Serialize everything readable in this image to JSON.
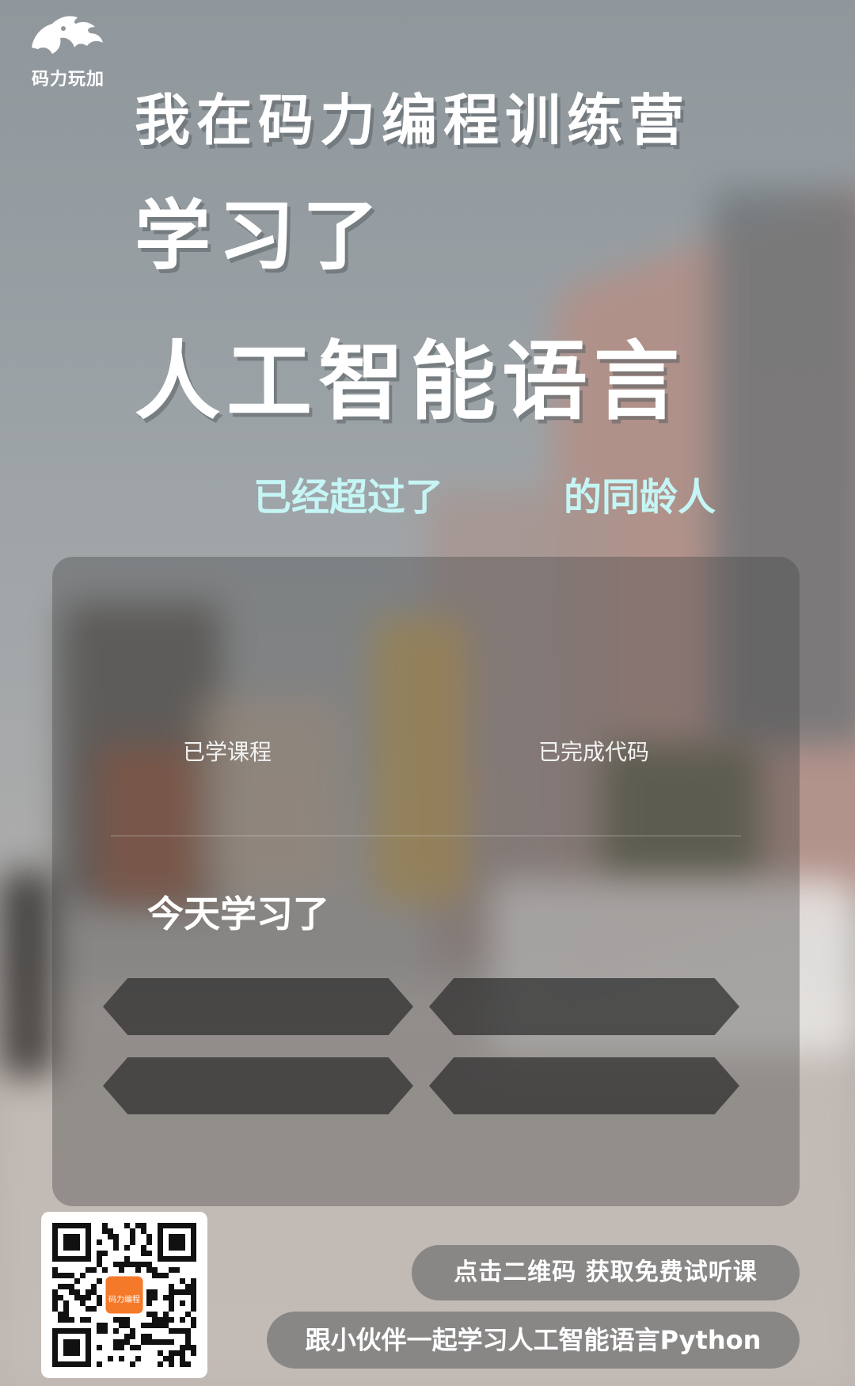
{
  "brand": {
    "logo_text": "码力玩加",
    "qr_badge_text": "码力编程"
  },
  "headline": {
    "line1": "我在码力编程训练营",
    "line2": "学习了",
    "line3": "人工智能语言"
  },
  "comparison": {
    "left_text": "已经超过了",
    "right_text": "的同龄人"
  },
  "card": {
    "stat_left_label": "已学课程",
    "stat_right_label": "已完成代码",
    "today_title": "今天学习了"
  },
  "cta": {
    "qr_button_label": "点击二维码 获取免费试听课",
    "study_button_label": "跟小伙伴一起学习人工智能语言Python"
  },
  "colors": {
    "accent_text": "#c5f5f5",
    "headline_text": "#ffffff"
  }
}
